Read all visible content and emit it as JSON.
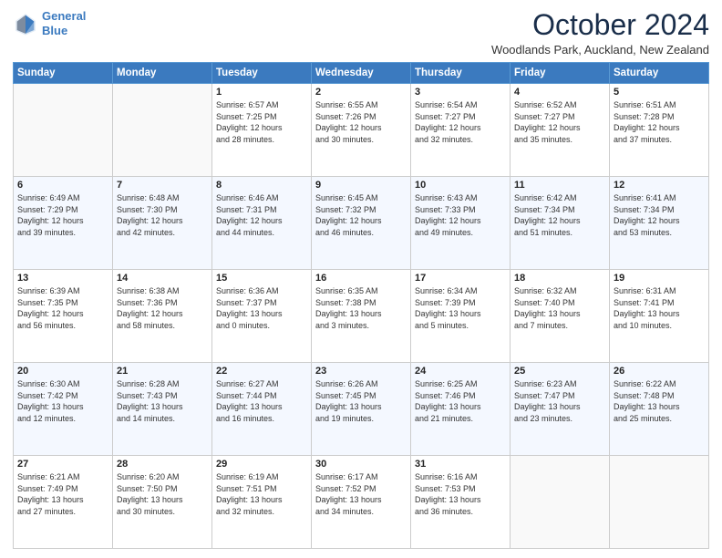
{
  "logo": {
    "line1": "General",
    "line2": "Blue"
  },
  "title": "October 2024",
  "location": "Woodlands Park, Auckland, New Zealand",
  "days_of_week": [
    "Sunday",
    "Monday",
    "Tuesday",
    "Wednesday",
    "Thursday",
    "Friday",
    "Saturday"
  ],
  "weeks": [
    [
      {
        "num": "",
        "info": ""
      },
      {
        "num": "",
        "info": ""
      },
      {
        "num": "1",
        "info": "Sunrise: 6:57 AM\nSunset: 7:25 PM\nDaylight: 12 hours\nand 28 minutes."
      },
      {
        "num": "2",
        "info": "Sunrise: 6:55 AM\nSunset: 7:26 PM\nDaylight: 12 hours\nand 30 minutes."
      },
      {
        "num": "3",
        "info": "Sunrise: 6:54 AM\nSunset: 7:27 PM\nDaylight: 12 hours\nand 32 minutes."
      },
      {
        "num": "4",
        "info": "Sunrise: 6:52 AM\nSunset: 7:27 PM\nDaylight: 12 hours\nand 35 minutes."
      },
      {
        "num": "5",
        "info": "Sunrise: 6:51 AM\nSunset: 7:28 PM\nDaylight: 12 hours\nand 37 minutes."
      }
    ],
    [
      {
        "num": "6",
        "info": "Sunrise: 6:49 AM\nSunset: 7:29 PM\nDaylight: 12 hours\nand 39 minutes."
      },
      {
        "num": "7",
        "info": "Sunrise: 6:48 AM\nSunset: 7:30 PM\nDaylight: 12 hours\nand 42 minutes."
      },
      {
        "num": "8",
        "info": "Sunrise: 6:46 AM\nSunset: 7:31 PM\nDaylight: 12 hours\nand 44 minutes."
      },
      {
        "num": "9",
        "info": "Sunrise: 6:45 AM\nSunset: 7:32 PM\nDaylight: 12 hours\nand 46 minutes."
      },
      {
        "num": "10",
        "info": "Sunrise: 6:43 AM\nSunset: 7:33 PM\nDaylight: 12 hours\nand 49 minutes."
      },
      {
        "num": "11",
        "info": "Sunrise: 6:42 AM\nSunset: 7:34 PM\nDaylight: 12 hours\nand 51 minutes."
      },
      {
        "num": "12",
        "info": "Sunrise: 6:41 AM\nSunset: 7:34 PM\nDaylight: 12 hours\nand 53 minutes."
      }
    ],
    [
      {
        "num": "13",
        "info": "Sunrise: 6:39 AM\nSunset: 7:35 PM\nDaylight: 12 hours\nand 56 minutes."
      },
      {
        "num": "14",
        "info": "Sunrise: 6:38 AM\nSunset: 7:36 PM\nDaylight: 12 hours\nand 58 minutes."
      },
      {
        "num": "15",
        "info": "Sunrise: 6:36 AM\nSunset: 7:37 PM\nDaylight: 13 hours\nand 0 minutes."
      },
      {
        "num": "16",
        "info": "Sunrise: 6:35 AM\nSunset: 7:38 PM\nDaylight: 13 hours\nand 3 minutes."
      },
      {
        "num": "17",
        "info": "Sunrise: 6:34 AM\nSunset: 7:39 PM\nDaylight: 13 hours\nand 5 minutes."
      },
      {
        "num": "18",
        "info": "Sunrise: 6:32 AM\nSunset: 7:40 PM\nDaylight: 13 hours\nand 7 minutes."
      },
      {
        "num": "19",
        "info": "Sunrise: 6:31 AM\nSunset: 7:41 PM\nDaylight: 13 hours\nand 10 minutes."
      }
    ],
    [
      {
        "num": "20",
        "info": "Sunrise: 6:30 AM\nSunset: 7:42 PM\nDaylight: 13 hours\nand 12 minutes."
      },
      {
        "num": "21",
        "info": "Sunrise: 6:28 AM\nSunset: 7:43 PM\nDaylight: 13 hours\nand 14 minutes."
      },
      {
        "num": "22",
        "info": "Sunrise: 6:27 AM\nSunset: 7:44 PM\nDaylight: 13 hours\nand 16 minutes."
      },
      {
        "num": "23",
        "info": "Sunrise: 6:26 AM\nSunset: 7:45 PM\nDaylight: 13 hours\nand 19 minutes."
      },
      {
        "num": "24",
        "info": "Sunrise: 6:25 AM\nSunset: 7:46 PM\nDaylight: 13 hours\nand 21 minutes."
      },
      {
        "num": "25",
        "info": "Sunrise: 6:23 AM\nSunset: 7:47 PM\nDaylight: 13 hours\nand 23 minutes."
      },
      {
        "num": "26",
        "info": "Sunrise: 6:22 AM\nSunset: 7:48 PM\nDaylight: 13 hours\nand 25 minutes."
      }
    ],
    [
      {
        "num": "27",
        "info": "Sunrise: 6:21 AM\nSunset: 7:49 PM\nDaylight: 13 hours\nand 27 minutes."
      },
      {
        "num": "28",
        "info": "Sunrise: 6:20 AM\nSunset: 7:50 PM\nDaylight: 13 hours\nand 30 minutes."
      },
      {
        "num": "29",
        "info": "Sunrise: 6:19 AM\nSunset: 7:51 PM\nDaylight: 13 hours\nand 32 minutes."
      },
      {
        "num": "30",
        "info": "Sunrise: 6:17 AM\nSunset: 7:52 PM\nDaylight: 13 hours\nand 34 minutes."
      },
      {
        "num": "31",
        "info": "Sunrise: 6:16 AM\nSunset: 7:53 PM\nDaylight: 13 hours\nand 36 minutes."
      },
      {
        "num": "",
        "info": ""
      },
      {
        "num": "",
        "info": ""
      }
    ]
  ]
}
